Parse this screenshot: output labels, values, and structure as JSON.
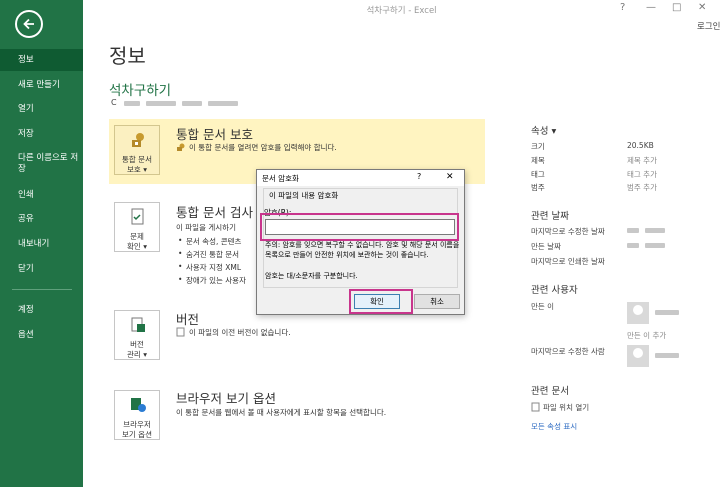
{
  "window": {
    "title": "석차구하기 - Excel",
    "help": "?",
    "minimize": "—",
    "restore": "□",
    "close": "✕",
    "login": "로그인"
  },
  "sidebar": {
    "items": [
      {
        "label": "정보",
        "active": true
      },
      {
        "label": "새로 만들기"
      },
      {
        "label": "열기"
      },
      {
        "label": "저장"
      },
      {
        "label": "다른 이름으로 저장"
      },
      {
        "label": "인쇄"
      },
      {
        "label": "공유"
      },
      {
        "label": "내보내기"
      },
      {
        "label": "닫기"
      },
      {
        "label": "계정"
      },
      {
        "label": "옵션"
      }
    ]
  },
  "main": {
    "title": "정보",
    "doc_name": "석차구하기",
    "doc_path_prefix": "C",
    "sections": {
      "protect": {
        "button": "통합 문서\n보호 ▾",
        "heading": "통합 문서 보호",
        "desc": "이 통합 문서를 열려면 암호를 입력해야 합니다."
      },
      "inspect": {
        "button": "문제\n확인 ▾",
        "heading": "통합 문서 검사",
        "desc": "이 파일을 게시하기",
        "bullets": [
          "문서 속성, 콘텐츠",
          "숨겨진 통합 문서",
          "사용자 지정 XML",
          "장애가 있는 사용자"
        ]
      },
      "version": {
        "button": "버전\n관리 ▾",
        "heading": "버전",
        "desc": "이 파일의 이전 버전이 없습니다."
      },
      "browser": {
        "button": "브라우저\n보기 옵션",
        "heading": "브라우저 보기 옵션",
        "desc": "이 통합 문서를 웹에서 볼 때 사용자에게 표시할 항목을 선택합니다."
      }
    }
  },
  "properties": {
    "heading": "속성 ▾",
    "rows": [
      {
        "label": "크기",
        "value": "20.5KB"
      },
      {
        "label": "제목",
        "value": "제목 추가"
      },
      {
        "label": "태그",
        "value": "태그 추가"
      },
      {
        "label": "범주",
        "value": "범주 추가"
      }
    ],
    "dates_heading": "관련 날짜",
    "dates": [
      {
        "label": "마지막으로 수정한 날짜"
      },
      {
        "label": "만든 날짜"
      },
      {
        "label": "마지막으로 인쇄한 날짜"
      }
    ],
    "people_heading": "관련 사용자",
    "author_label": "만든 이",
    "add_author": "만든 이 추가",
    "last_modified_by": "마지막으로 수정한 사람",
    "docs_heading": "관련 문서",
    "open_location": "파일 위치 열기",
    "show_all": "모든 속성 표시"
  },
  "dialog": {
    "title": "문서 암호화",
    "help": "?",
    "close": "✕",
    "group_title": "이 파일의 내용 암호화",
    "pw_label": "암호(R):",
    "pw_value": "",
    "warning": "주의: 암호를 잊으면 복구할 수 없습니다. 암호 및 해당 문서 이름을 목록으로 만들어 안전한 위치에 보관하는 것이 좋습니다.",
    "note": "암호는 대/소문자를 구분합니다.",
    "ok": "확인",
    "cancel": "취소"
  },
  "colors": {
    "accent": "#217346",
    "highlight": "#c8358c",
    "protect_bg": "#fff4c1"
  }
}
